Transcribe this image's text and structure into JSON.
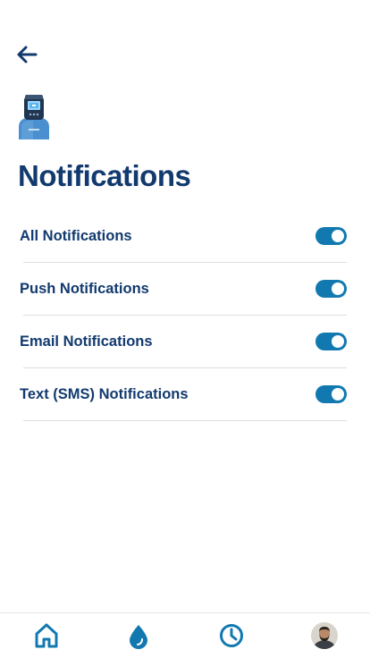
{
  "header": {
    "back_icon": "arrow-left-icon",
    "device_image": "water-softener-device-icon"
  },
  "page": {
    "title": "Notifications"
  },
  "settings": [
    {
      "label": "All Notifications",
      "enabled": true
    },
    {
      "label": "Push Notifications",
      "enabled": true
    },
    {
      "label": "Email Notifications",
      "enabled": true
    },
    {
      "label": "Text (SMS) Notifications",
      "enabled": true
    }
  ],
  "tab_bar": {
    "items": [
      {
        "icon": "home-icon"
      },
      {
        "icon": "water-drop-icon"
      },
      {
        "icon": "clock-icon"
      },
      {
        "icon": "user-avatar"
      }
    ]
  },
  "colors": {
    "primary_text": "#123a6e",
    "accent": "#1279b0",
    "divider": "#dcdcdc"
  }
}
